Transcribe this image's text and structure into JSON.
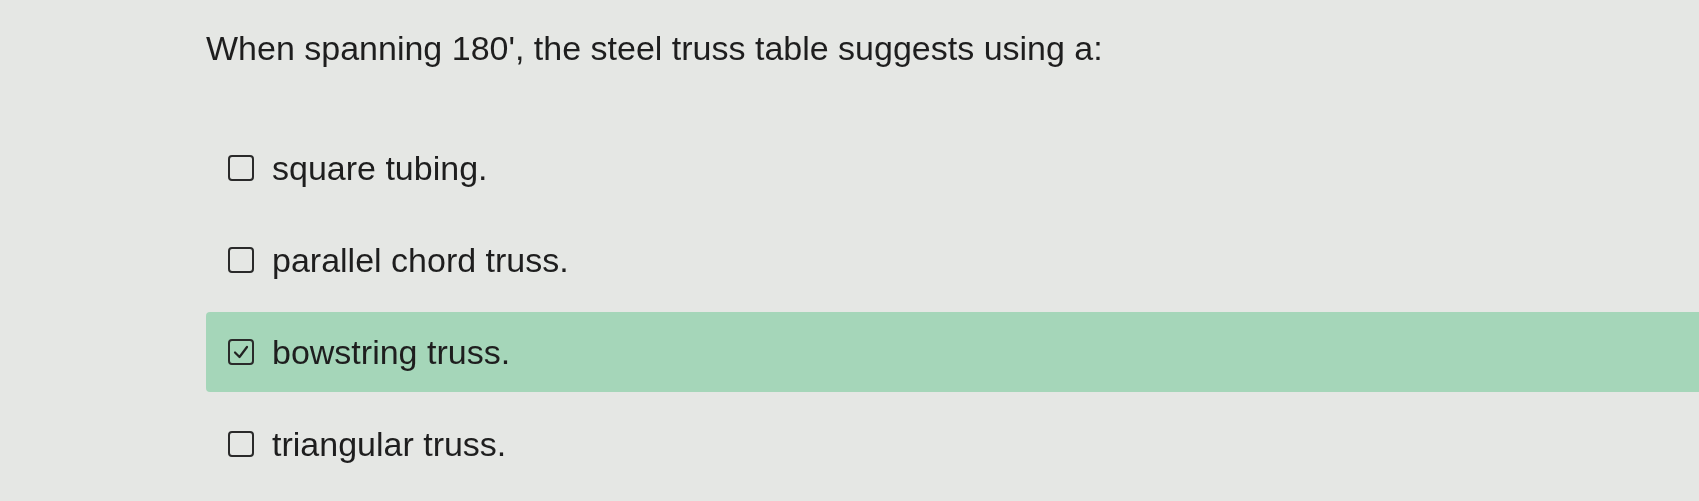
{
  "question": "When spanning 180', the steel truss table suggests using a:",
  "options": [
    {
      "label": "square tubing.",
      "checked": false,
      "selected": false
    },
    {
      "label": "parallel chord truss.",
      "checked": false,
      "selected": false
    },
    {
      "label": "bowstring truss.",
      "checked": true,
      "selected": true
    },
    {
      "label": "triangular truss.",
      "checked": false,
      "selected": false
    }
  ]
}
